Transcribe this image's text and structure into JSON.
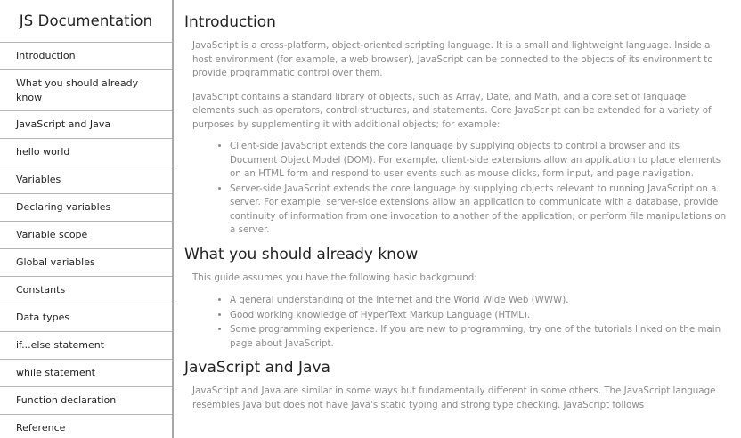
{
  "navbar": {
    "title": "JS Documentation",
    "items": [
      {
        "label": "Introduction",
        "two_line": false
      },
      {
        "label": "What you should already know",
        "two_line": true
      },
      {
        "label": "JavaScript and Java",
        "two_line": false
      },
      {
        "label": "hello world",
        "two_line": false
      },
      {
        "label": "Variables",
        "two_line": false
      },
      {
        "label": "Declaring variables",
        "two_line": false
      },
      {
        "label": "Variable scope",
        "two_line": false
      },
      {
        "label": "Global variables",
        "two_line": false
      },
      {
        "label": "Constants",
        "two_line": false
      },
      {
        "label": "Data types",
        "two_line": false
      },
      {
        "label": "if...else statement",
        "two_line": false
      },
      {
        "label": "while statement",
        "two_line": false
      },
      {
        "label": "Function declaration",
        "two_line": false
      },
      {
        "label": "Reference",
        "two_line": false
      }
    ]
  },
  "main": {
    "sections": [
      {
        "id": "sec-1",
        "title": "Introduction",
        "paragraphs": [
          "JavaScript is a cross-platform, object-oriented scripting language. It is a small and lightweight language. Inside a host environment (for example, a web browser), JavaScript can be connected to the objects of its environment to provide programmatic control over them.",
          "JavaScript contains a standard library of objects, such as Array, Date, and Math, and a core set of language elements such as operators, control structures, and statements. Core JavaScript can be extended for a variety of purposes by supplementing it with additional objects; for example:"
        ],
        "bullets": [
          "Client-side JavaScript extends the core language by supplying objects to control a browser and its Document Object Model (DOM). For example, client-side extensions allow an application to place elements on an HTML form and respond to user events such as mouse clicks, form input, and page navigation.",
          "Server-side JavaScript extends the core language by supplying objects relevant to running JavaScript on a server. For example, server-side extensions allow an application to communicate with a database, provide continuity of information from one invocation to another of the application, or perform file manipulations on a server."
        ]
      },
      {
        "id": "sec-2",
        "title": "What you should already know",
        "paragraphs": [
          "This guide assumes you have the following basic background:"
        ],
        "bullets": [
          "A general understanding of the Internet and the World Wide Web (WWW).",
          "Good working knowledge of HyperText Markup Language (HTML).",
          "Some programming experience. If you are new to programming, try one of the tutorials linked on the main page about JavaScript."
        ]
      },
      {
        "id": "sec-3",
        "title": "JavaScript and Java",
        "paragraphs": [
          "JavaScript and Java are similar in some ways but fundamentally different in some others. The JavaScript language resembles Java but does not have Java's static typing and strong type checking. JavaScript follows"
        ],
        "bullets": []
      }
    ]
  }
}
